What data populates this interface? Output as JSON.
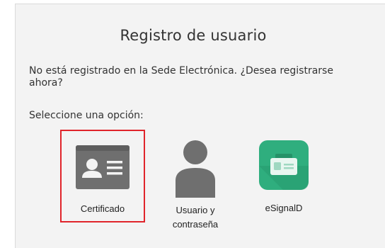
{
  "dialog": {
    "title": "Registro de usuario",
    "question": "No está registrado en la Sede Electrónica. ¿Desea registrarse ahora?",
    "prompt": "Seleccione una opción:"
  },
  "options": [
    {
      "label": "Certificado",
      "icon": "id-card-icon",
      "selected": true
    },
    {
      "label_line1": "Usuario y",
      "label_line2": "contraseña",
      "icon": "user-icon",
      "selected": false
    },
    {
      "label": "eSignalD",
      "icon": "esignid-badge-icon",
      "selected": false
    }
  ],
  "colors": {
    "panel_background": "#f3f3f3",
    "icon_gray": "#6f6f6f",
    "esign_green": "#2fae7e",
    "selection_border": "#e0242b"
  }
}
